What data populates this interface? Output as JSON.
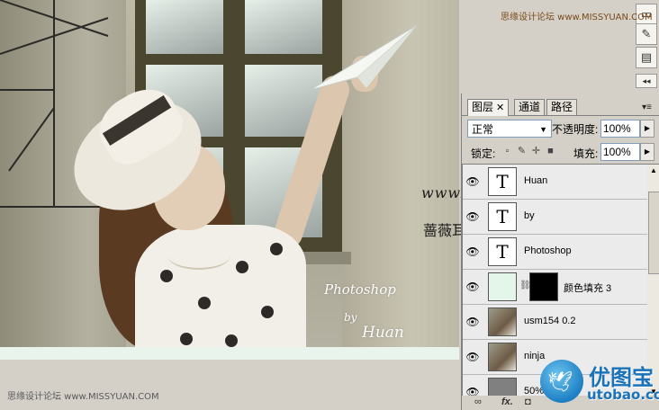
{
  "watermarks": {
    "top": "思缘设计论坛 www.MISSYUAN.COM",
    "bottom": "思缘设计论坛 www.MISSYUAN.COM",
    "url_handwritten": "www.missyuan.com",
    "cn_handwritten": "蔷薇耳环"
  },
  "photo_signature": {
    "line1": "Photoshop",
    "line2": "by",
    "line3": "Huan"
  },
  "dock": {
    "icons": [
      "brush-presets-icon",
      "tool-presets-icon",
      "layer-comps-icon",
      "panel-collapse-icon"
    ]
  },
  "panel": {
    "tabs": [
      {
        "label": "图层",
        "active": true
      },
      {
        "label": "通道",
        "active": false
      },
      {
        "label": "路径",
        "active": false
      }
    ],
    "blend_mode": "正常",
    "opacity_label": "不透明度:",
    "opacity_value": "100%",
    "lock_label": "锁定:",
    "fill_label": "填充:",
    "fill_value": "100%",
    "layers": [
      {
        "name": "Huan",
        "kind": "text",
        "thumb": "T"
      },
      {
        "name": "by",
        "kind": "text",
        "thumb": "T"
      },
      {
        "name": "Photoshop",
        "kind": "text",
        "thumb": "T"
      },
      {
        "name": "颜色填充 3",
        "kind": "fill",
        "thumb": ""
      },
      {
        "name": "usm154 0.2",
        "kind": "photo",
        "thumb": ""
      },
      {
        "name": "ninja",
        "kind": "photo",
        "thumb": ""
      },
      {
        "name": "50%",
        "kind": "grey",
        "thumb": ""
      }
    ],
    "footer": {
      "link": "∞",
      "fx": "fx.",
      "mask": "◘"
    }
  },
  "logo": {
    "cn": "优图宝",
    "url": "utobao.com"
  }
}
